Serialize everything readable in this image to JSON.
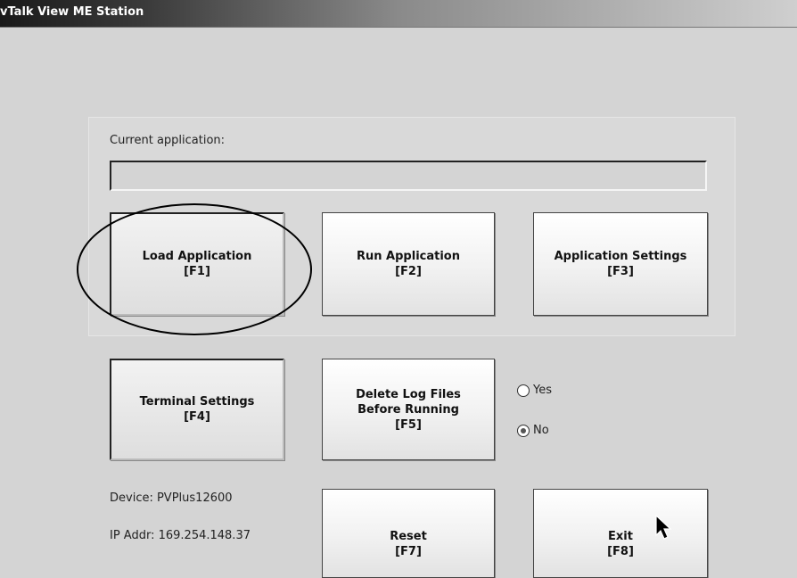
{
  "window": {
    "title": "ⅴTalk View ME Station"
  },
  "current_app": {
    "label": "Current application:",
    "value": ""
  },
  "buttons": {
    "load": "Load Application\n[F1]",
    "run": "Run Application\n[F2]",
    "settings": "Application Settings\n[F3]",
    "terminal": "Terminal Settings\n[F4]",
    "delete_logs": "Delete Log Files\nBefore Running\n[F5]",
    "reset": "Reset\n[F7]",
    "exit": "Exit\n[F8]"
  },
  "delete_option": {
    "yes": "Yes",
    "no": "No",
    "selected": "No"
  },
  "device": {
    "name": "Device: PVPlus12600",
    "ip": "IP Addr: 169.254.148.37"
  },
  "annotations": {
    "highlight_circle": "load-application-button"
  },
  "colors": {
    "background": "#d4d4d4",
    "titlebar": "#1a1a1a"
  }
}
